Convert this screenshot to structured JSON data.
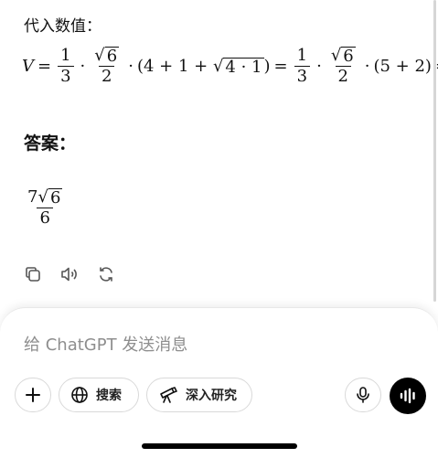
{
  "message": {
    "intro": "代入数值：",
    "equation": {
      "lhs": "V",
      "eq": "=",
      "frac_one_third": {
        "num": "1",
        "den": "3"
      },
      "frac_root6_over_2": {
        "num_radicand": "6",
        "den": "2"
      },
      "paren1_prefix": "(4 + 1 + ",
      "paren1_radicand": "4 · 1",
      "paren1_suffix": ")",
      "paren2": "(5 + 2)",
      "cdot": "·"
    },
    "answer_heading": "答案：",
    "answer": {
      "num_coef": "7",
      "num_radicand": "6",
      "den": "6"
    }
  },
  "actions": {
    "copy_icon": "copy-icon",
    "read_aloud_icon": "speaker-icon",
    "regenerate_icon": "refresh-icon"
  },
  "composer": {
    "placeholder": "给 ChatGPT 发送消息",
    "search_label": "搜索",
    "research_label": "深入研究"
  }
}
